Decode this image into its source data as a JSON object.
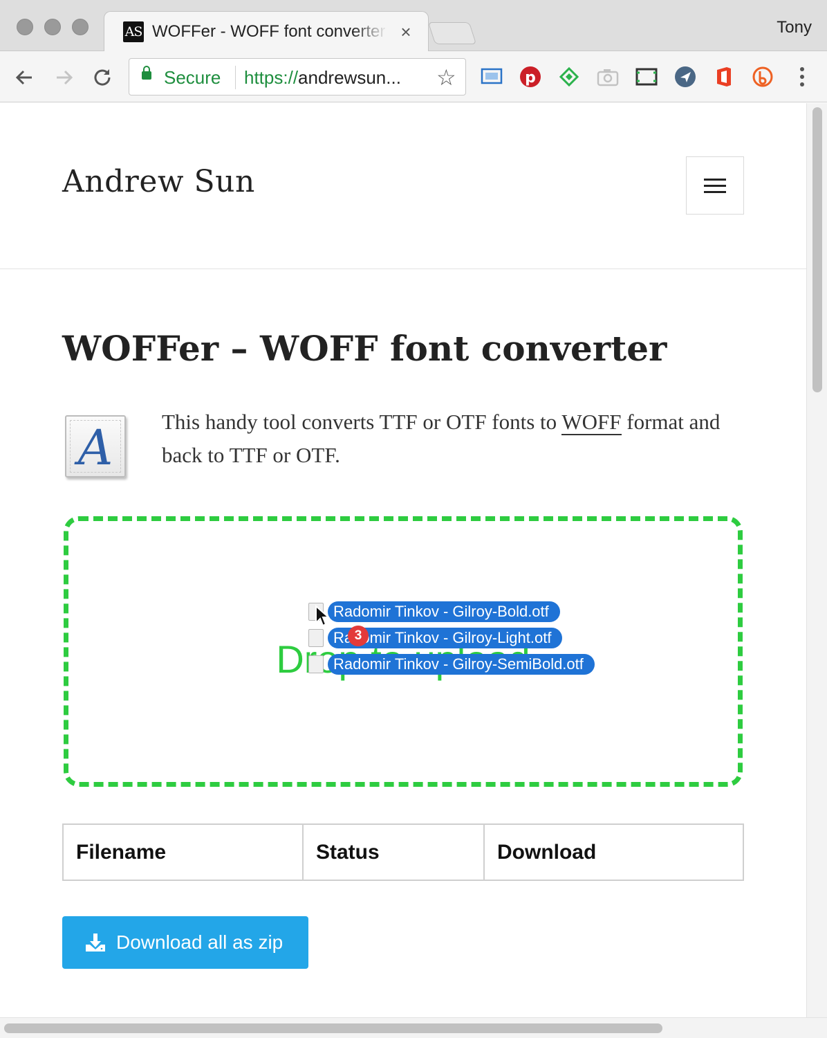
{
  "browser": {
    "tab_title": "WOFFer - WOFF font converter",
    "tab_favicon_text": "AS",
    "profile_name": "Tony",
    "security_label": "Secure",
    "url_scheme": "https://",
    "url_rest": "andrewsun...",
    "icons": {
      "back": "back-arrow-icon",
      "forward": "forward-arrow-icon",
      "reload": "reload-icon",
      "bookmark": "star-icon",
      "extensions": [
        "cast-screen-icon",
        "pinterest-icon",
        "feedly-icon",
        "camera-icon",
        "screenshot-icon",
        "send-icon",
        "office-icon",
        "bitly-icon"
      ]
    }
  },
  "site": {
    "title": "Andrew Sun"
  },
  "page": {
    "heading": "WOFFer – WOFF font converter",
    "intro_part1": "This handy tool converts TTF or OTF fonts to",
    "intro_abbr": "WOFF",
    "intro_part2": "format and back to TTF or OTF.",
    "font_icon_letter": "A",
    "dropzone_text": "Drop to upload",
    "dragged_files": [
      "Radomir Tinkov - Gilroy-Bold.otf",
      "Radomir Tinkov - Gilroy-Light.otf",
      "Radomir Tinkov - Gilroy-SemiBold.otf"
    ],
    "drag_count": "3",
    "table": {
      "headers": [
        "Filename",
        "Status",
        "Download"
      ]
    },
    "zip_button_label": "Download all as zip"
  },
  "colors": {
    "accent_green": "#2ecc40",
    "drag_blue": "#1f73d6",
    "button_blue": "#23a6e8",
    "secure_green": "#1e8e3e",
    "badge_red": "#e33a3a"
  }
}
